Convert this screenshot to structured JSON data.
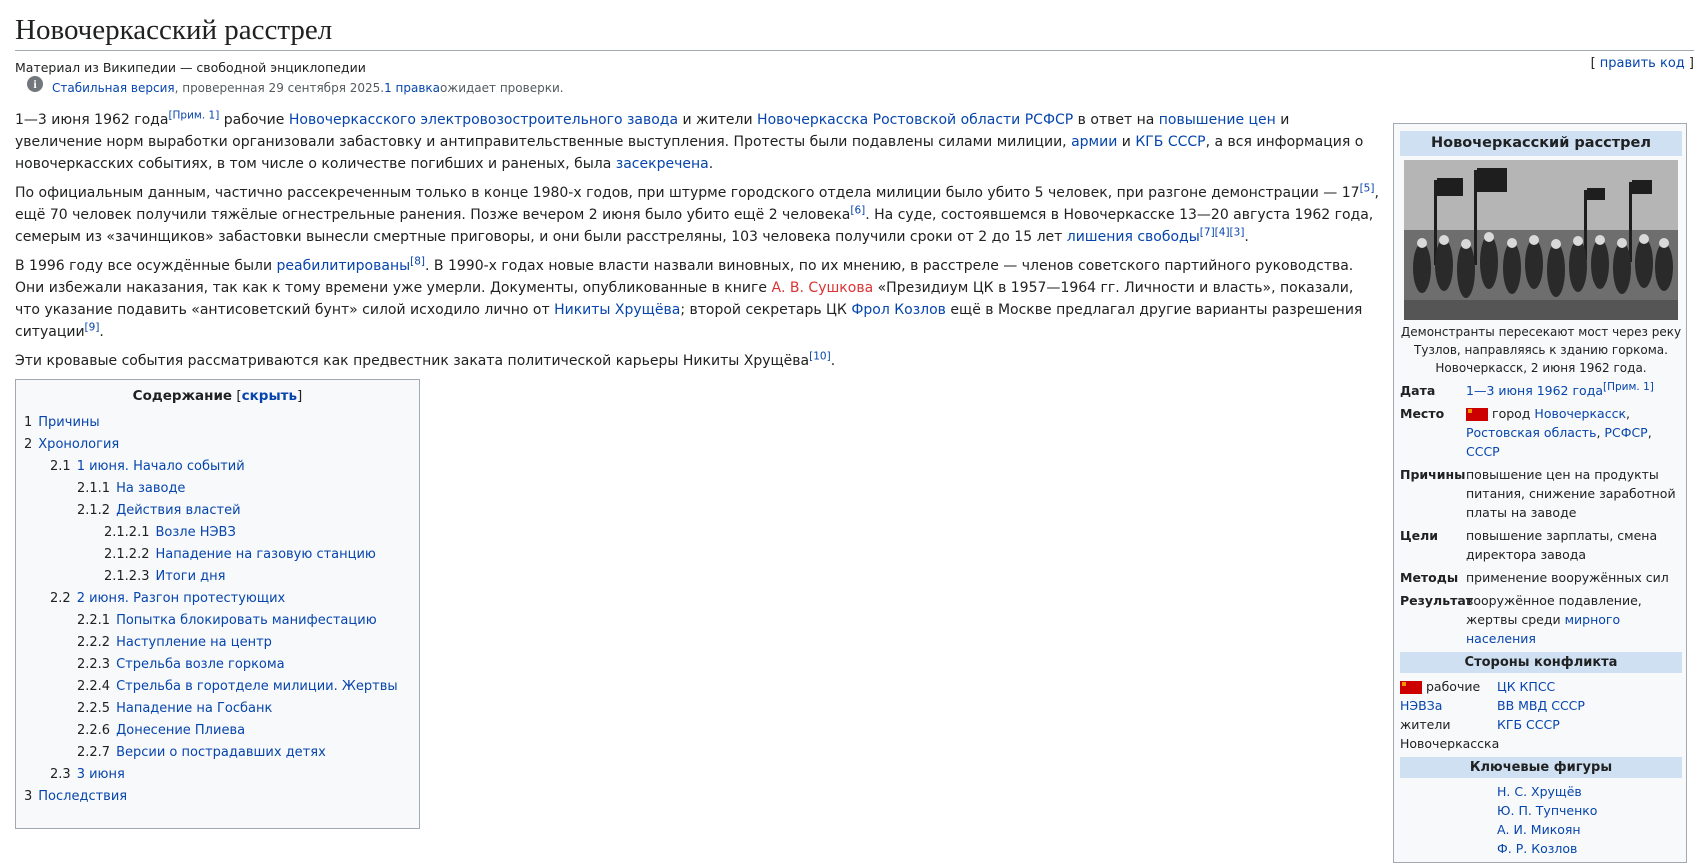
{
  "title": "Новочеркасский расстрел",
  "site_sub": "Материал из Википедии — свободной энциклопедии",
  "edit": {
    "open": "[ ",
    "label": "править код",
    "close": " ]"
  },
  "flagged": {
    "stable": "Стабильная версия",
    "checked": ", проверенная 29 сентября 2025. ",
    "edits": "1 правка",
    "pending": " ожидает проверки."
  },
  "intro": {
    "p1": {
      "t1": "1—3 июня 1962 года",
      "n1": "[Прим. 1]",
      "t2": " рабочие ",
      "l1": "Новочеркасского электровозостроительного завода",
      "t3": " и жители ",
      "l2": "Новочеркасска",
      "t4": " ",
      "l3": "Ростовской области",
      "t5": " ",
      "l4": "РСФСР",
      "t6": " в ответ на ",
      "l5": "повышение цен",
      "t7": " и увеличение норм выработки организовали забастовку и антиправительственные выступления. Протесты были подавлены силами милиции, ",
      "l6": "армии",
      "t8": " и ",
      "l7": "КГБ СССР",
      "t9": ", а вся информация о новочеркасских событиях, в том числе о количестве погибших и раненых, была ",
      "l8": "засекречена",
      "t10": "."
    },
    "p2": {
      "t1": "По официальным данным, частично рассекреченным только в конце 1980-х годов, при штурме городского отдела милиции было убито 5 человек, при разгоне демонстрации — 17",
      "n1": "[5]",
      "t2": ", ещё 70 человек получили тяжёлые огнестрельные ранения. Позже вечером 2 июня было убито ещё 2 человека",
      "n2": "[6]",
      "t3": ". На суде, состоявшемся в Новочеркасске 13—20 августа 1962 года, семерым из «зачинщиков» забастовки вынесли смертные приговоры, и они были расстреляны, 103 человека получили сроки от 2 до 15 лет ",
      "l1": "лишения свободы",
      "n3": "[7][4][3]",
      "t4": "."
    },
    "p3": {
      "t1": "В 1996 году все осуждённые были ",
      "l1": "реабилитированы",
      "n1": "[8]",
      "t2": ". В 1990-х годах новые власти назвали виновных, по их мнению, в расстреле — членов советского партийного руководства. Они избежали наказания, так как к тому времени уже умерли. Документы, опубликованные в книге ",
      "l2": "А. В. Сушкова",
      "t3": " «Президиум ЦК в 1957—1964 гг. Личности и власть», показали, что указание подавить «антисоветский бунт» силой исходило лично от ",
      "l3": "Никиты Хрущёва",
      "t4": "; второй секретарь ЦК ",
      "l4": "Фрол Козлов",
      "t5": " ещё в Москве предлагал другие варианты разрешения ситуации",
      "n2": "[9]",
      "t6": "."
    },
    "p4": {
      "t1": "Эти кровавые события рассматриваются как предвестник заката политической карьеры Никиты Хрущёва",
      "n1": "[10]",
      "t2": "."
    }
  },
  "toc": {
    "title": "Содержание",
    "hide_open": " [",
    "hide": "скрыть",
    "hide_close": "]",
    "items": [
      {
        "num": "1",
        "label": "Причины"
      },
      {
        "num": "2",
        "label": "Хронология"
      },
      {
        "num": "2.1",
        "label": "1 июня. Начало событий"
      },
      {
        "num": "2.1.1",
        "label": "На заводе"
      },
      {
        "num": "2.1.2",
        "label": "Действия властей"
      },
      {
        "num": "2.1.2.1",
        "label": "Возле НЭВЗ"
      },
      {
        "num": "2.1.2.2",
        "label": "Нападение на газовую станцию"
      },
      {
        "num": "2.1.2.3",
        "label": "Итоги дня"
      },
      {
        "num": "2.2",
        "label": "2 июня. Разгон протестующих"
      },
      {
        "num": "2.2.1",
        "label": "Попытка блокировать манифестацию"
      },
      {
        "num": "2.2.2",
        "label": "Наступление на центр"
      },
      {
        "num": "2.2.3",
        "label": "Стрельба возле горкома"
      },
      {
        "num": "2.2.4",
        "label": "Стрельба в горотделе милиции. Жертвы"
      },
      {
        "num": "2.2.5",
        "label": "Нападение на Госбанк"
      },
      {
        "num": "2.2.6",
        "label": "Донесение Плиева"
      },
      {
        "num": "2.2.7",
        "label": "Версии о пострадавших детях"
      },
      {
        "num": "2.3",
        "label": "3 июня"
      },
      {
        "num": "3",
        "label": "Последствия"
      }
    ]
  },
  "infobox": {
    "title": "Новочеркасский расстрел",
    "caption": "Демонстранты пересекают мост через реку Тузлов, направляясь к зданию горкома. Новочеркасск, 2 июня 1962 года.",
    "date_label": "Дата",
    "date_value": "1—3 июня 1962 года",
    "date_note": "[Прим. 1]",
    "place_label": "Место",
    "place_text": "город ",
    "place_city": "Новочеркасск",
    "place_sep1": ",",
    "place_region": "Ростовская область",
    "place_sep2": ", ",
    "place_rsfsr": "РСФСР",
    "place_sep3": ", ",
    "place_ussr": "СССР",
    "causes_label": "Причины",
    "causes_value": "повышение цен на продукты питания, снижение заработной платы на заводе",
    "goals_label": "Цели",
    "goals_value": "повышение зарплаты, смена директора завода",
    "methods_label": "Методы",
    "methods_value": "применение вооружённых сил",
    "result_label": "Результат",
    "result_value": "вооружённое подавление, жертвы среди ",
    "result_link": "мирного населения",
    "sides_title": "Стороны конфликта",
    "side1": {
      "workers": "рабочие",
      "nevz": "НЭВЗа",
      "residents": "жители",
      "city": "Новочеркасска"
    },
    "side2": [
      "ЦК КПСС",
      "ВВ МВД СССР",
      "КГБ СССР"
    ],
    "figures_title": "Ключевые фигуры",
    "figures": [
      "Н. С. Хрущёв",
      "Ю. П. Тупченко",
      "А. И. Микоян",
      "Ф. Р. Козлов"
    ]
  },
  "colors": {
    "link": "#0645ad",
    "redlink": "#dd3333",
    "header_bg": "#cee0f2",
    "flag": "#cc0000"
  }
}
